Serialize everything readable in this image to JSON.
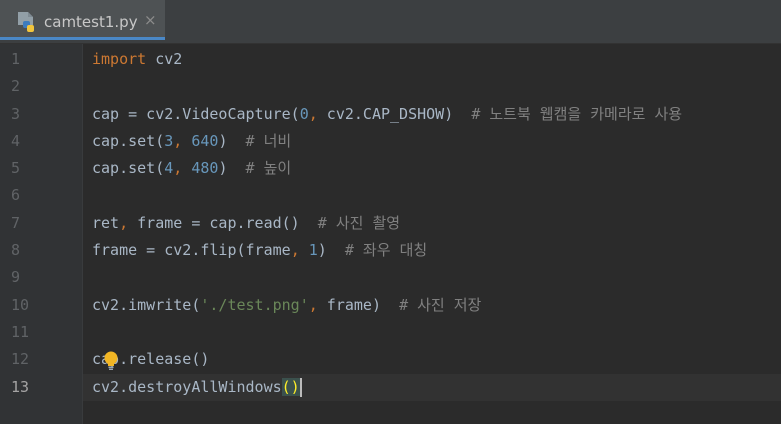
{
  "tab": {
    "filename": "camtest1.py",
    "close_glyph": "×",
    "icon": "python-file-icon"
  },
  "gutter": {
    "line_numbers": [
      "1",
      "2",
      "3",
      "4",
      "5",
      "6",
      "7",
      "8",
      "9",
      "10",
      "11",
      "12",
      "13"
    ]
  },
  "code": {
    "l1": {
      "kw": "import",
      "rest": " cv2"
    },
    "l3": {
      "a": "cap = cv2.VideoCapture(",
      "n1": "0",
      "p1": ",",
      "b": " cv2.CAP_DSHOW)  ",
      "c": "# 노트북 웹캠을 카메라로 사용"
    },
    "l4": {
      "a": "cap.set(",
      "n1": "3",
      "p1": ",",
      "sp": " ",
      "n2": "640",
      "b": ")  ",
      "c": "# 너비"
    },
    "l5": {
      "a": "cap.set(",
      "n1": "4",
      "p1": ",",
      "sp": " ",
      "n2": "480",
      "b": ")  ",
      "c": "# 높이"
    },
    "l7": {
      "a": "ret",
      "p1": ",",
      "b": " frame = cap.read()  ",
      "c": "# 사진 촬영"
    },
    "l8": {
      "a": "frame = cv2.flip(frame",
      "p1": ",",
      "sp": " ",
      "n1": "1",
      "b": ")  ",
      "c": "# 좌우 대칭"
    },
    "l10": {
      "a": "cv2.imwrite(",
      "s": "'./test.png'",
      "p1": ",",
      "b": " frame)  ",
      "c": "# 사진 저장"
    },
    "l12": {
      "a": "cap.release()"
    },
    "l13": {
      "a": "cv2.destroyAllWindows",
      "br": "()"
    }
  },
  "icons": {
    "intention": "lightbulb-icon"
  },
  "colors": {
    "background": "#2b2b2b",
    "keyword": "#cc7832",
    "number": "#6897bb",
    "string": "#6a8759",
    "comment": "#808080"
  }
}
